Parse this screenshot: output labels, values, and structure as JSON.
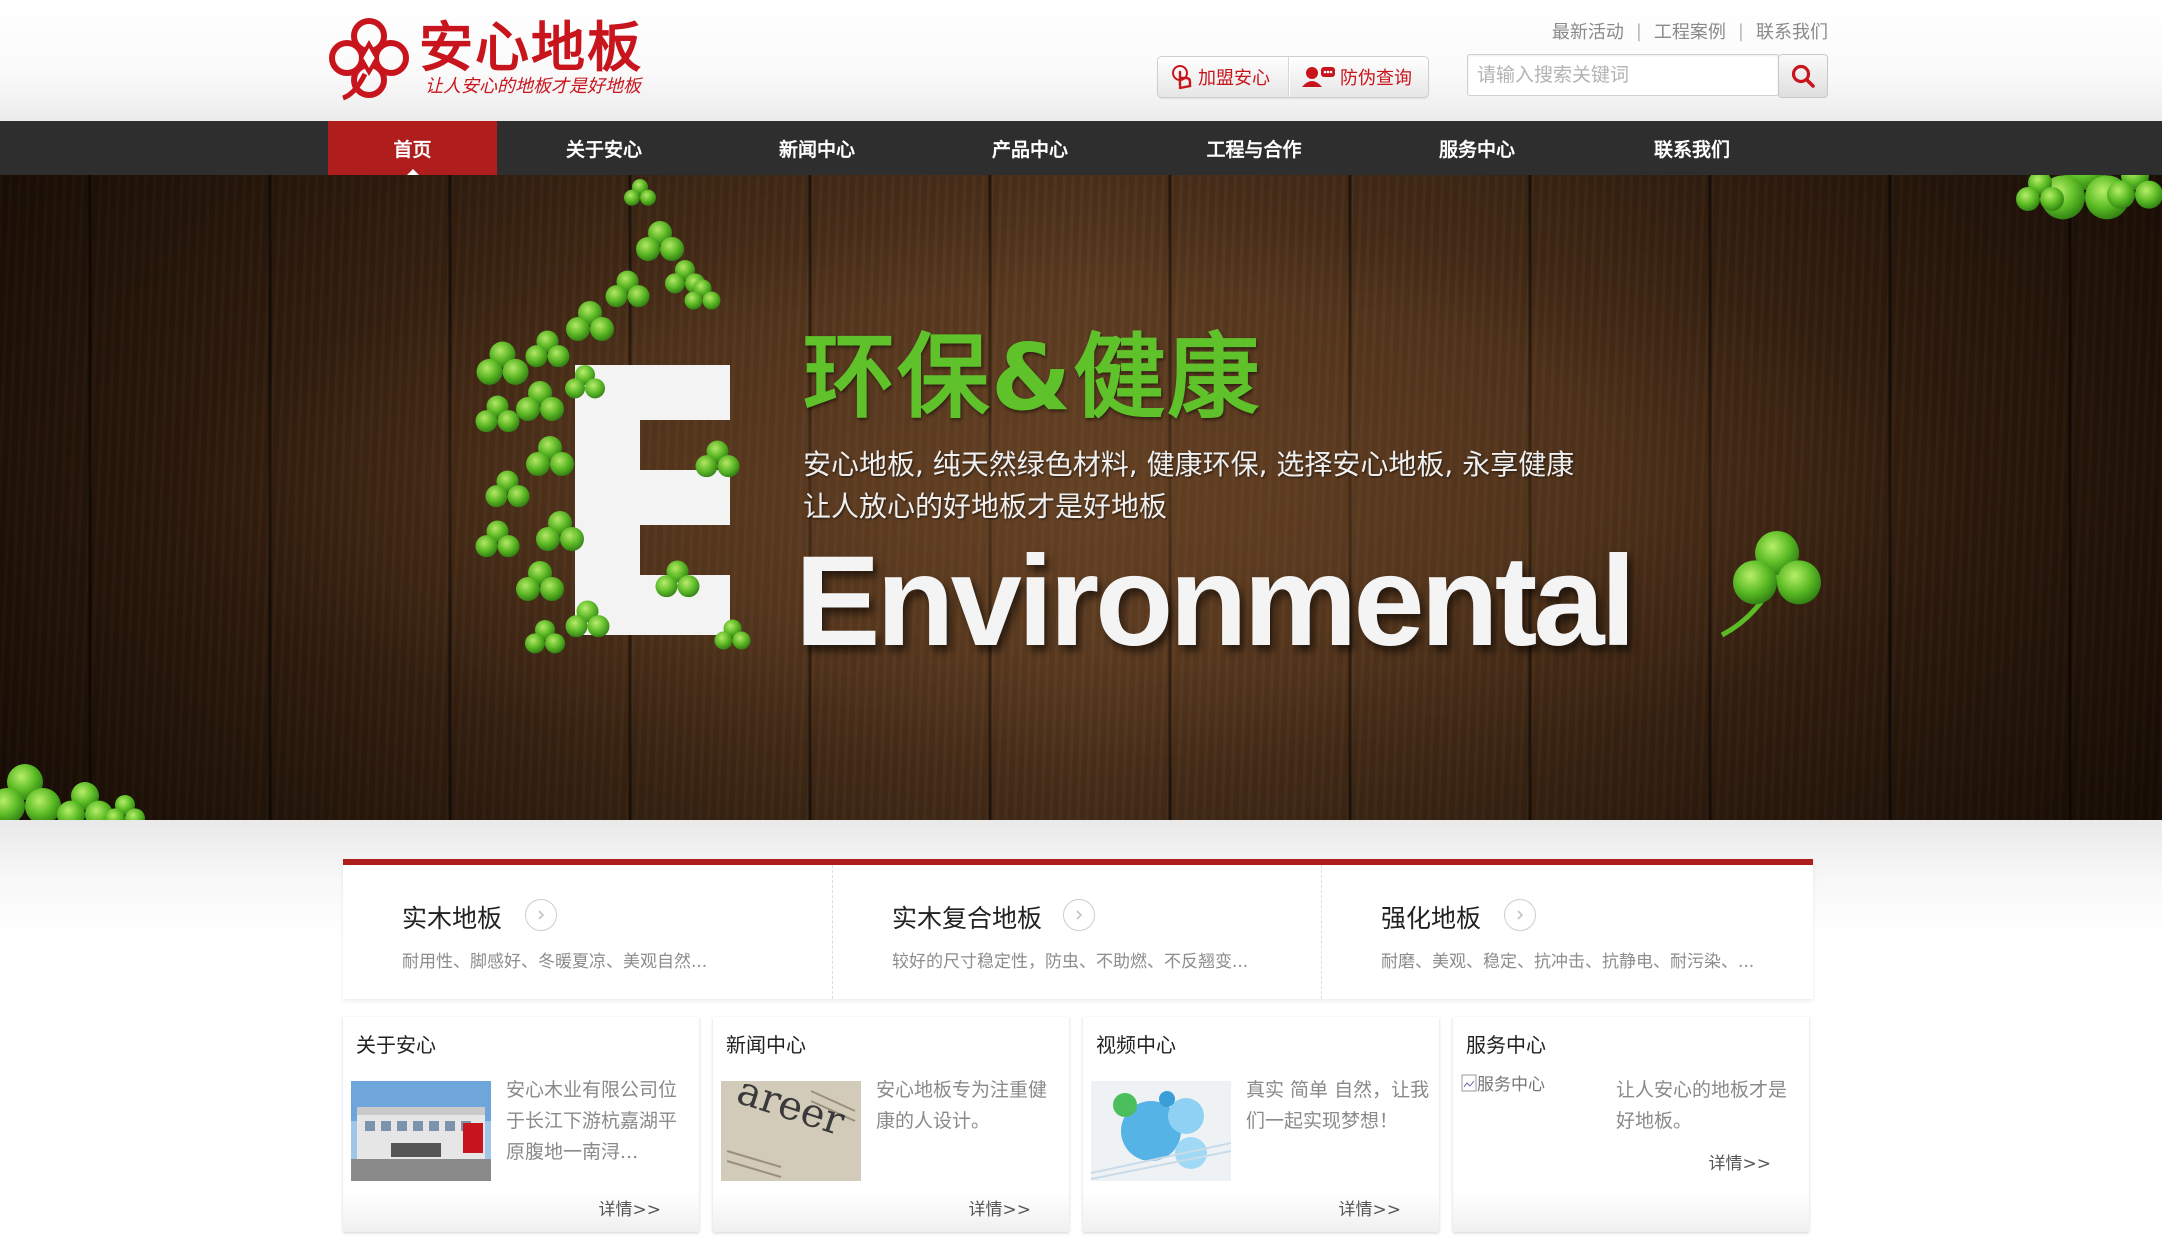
{
  "colors": {
    "brand_red": "#c8151d",
    "nav_bg": "#2e2e2e",
    "nav_active": "#b01d1d",
    "banner_green": "#5fc22b"
  },
  "header": {
    "logo": {
      "title": "安心地板",
      "slogan": "让人安心的地板才是好地板",
      "icon": "clover-logo-icon"
    },
    "top_links": [
      "最新活动",
      "工程案例",
      "联系我们"
    ],
    "top_link_separator": "|",
    "buttons": [
      {
        "label": "加盟安心",
        "icon": "pointer-hand-icon"
      },
      {
        "label": "防伪查询",
        "icon": "user-query-icon"
      }
    ],
    "search": {
      "placeholder": "请输入搜索关键词",
      "value": "",
      "icon": "search-icon"
    }
  },
  "nav": {
    "items": [
      "首页",
      "关于安心",
      "新闻中心",
      "产品中心",
      "工程与合作",
      "服务中心",
      "联系我们"
    ],
    "active_index": 0
  },
  "banner": {
    "heading": "环保&健康",
    "line1": "安心地板, 纯天然绿色材料, 健康环保, 选择安心地板, 永享健康",
    "line2": "让人放心的好地板才是好地板",
    "word": "Environmental"
  },
  "categories": [
    {
      "title": "实木地板",
      "desc": "耐用性、脚感好、冬暖夏凉、美观自然...",
      "arrow_icon": "chevron-right-circle-icon"
    },
    {
      "title": "实木复合地板",
      "desc": "较好的尺寸稳定性，防虫、不助燃、不反翘变...",
      "arrow_icon": "chevron-right-circle-icon"
    },
    {
      "title": "强化地板",
      "desc": "耐磨、美观、稳定、抗冲击、抗静电、耐污染、...",
      "arrow_icon": "chevron-right-circle-icon"
    }
  ],
  "cards": [
    {
      "title": "关于安心",
      "text": "安心木业有限公司位于长江下游杭嘉湖平原腹地一南浔...",
      "more": "详情>>"
    },
    {
      "title": "新闻中心",
      "text": "安心地板专为注重健康的人设计。",
      "more": "详情>>"
    },
    {
      "title": "视频中心",
      "text": "真实 简单 自然，让我们一起实现梦想！",
      "more": "详情>>"
    },
    {
      "title": "服务中心",
      "text": "让人安心的地板才是好地板。",
      "more": "详情>>",
      "image_alt": "服务中心"
    }
  ]
}
